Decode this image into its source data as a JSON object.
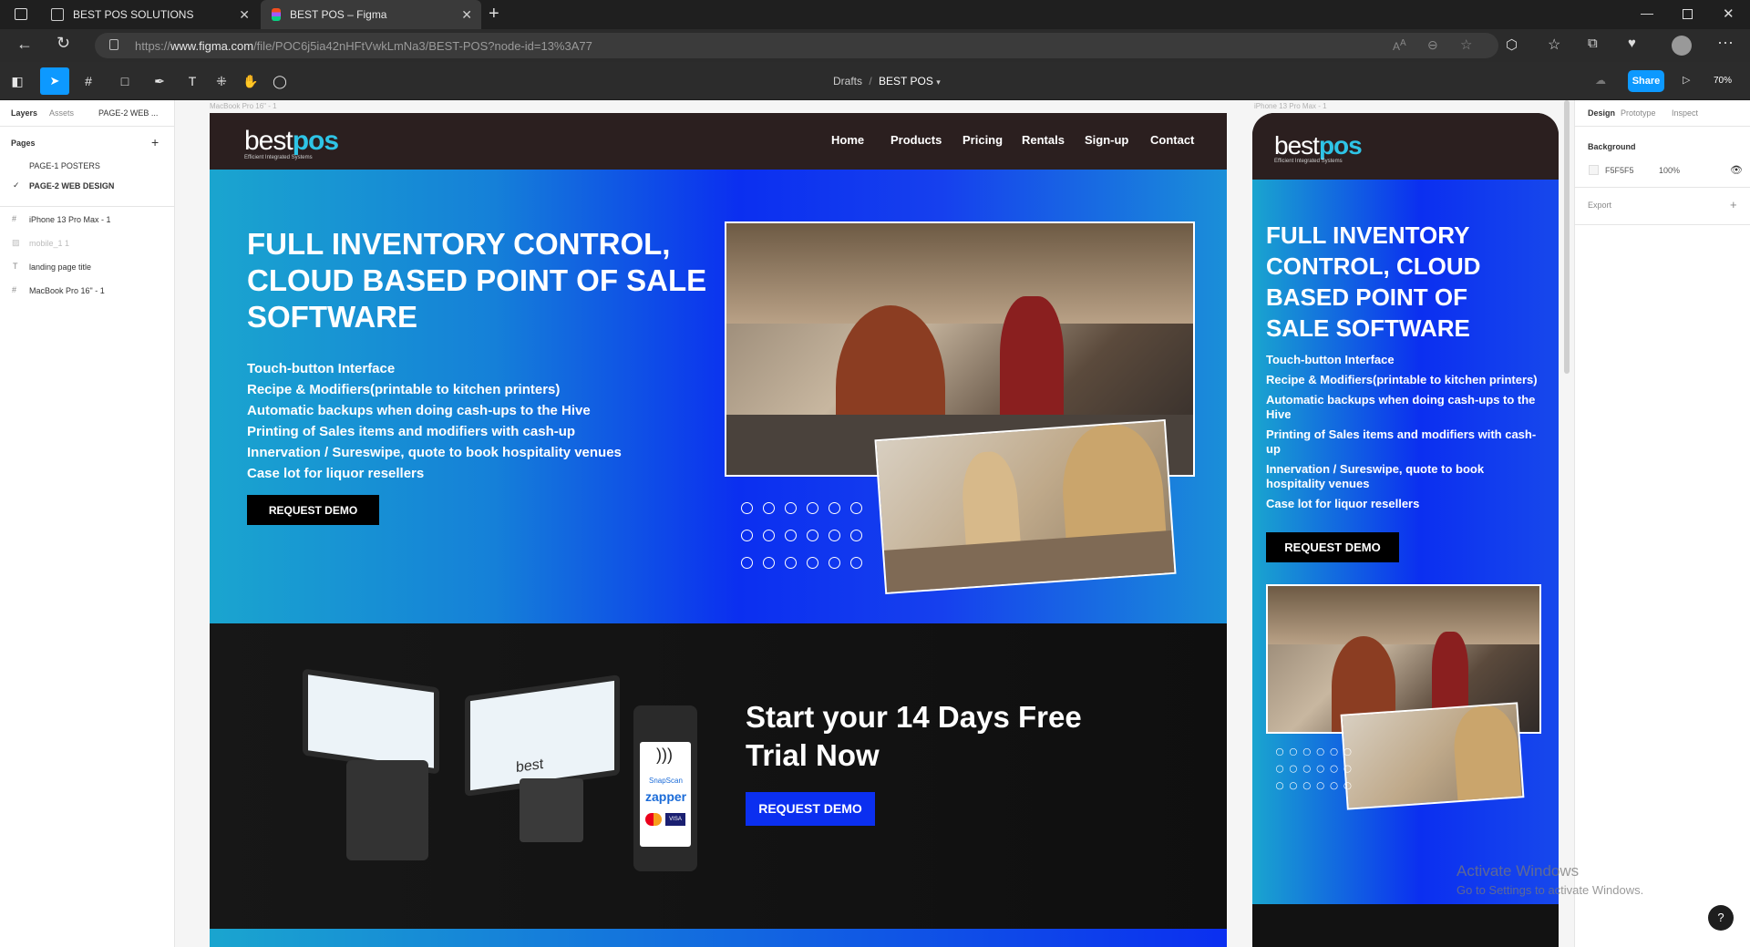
{
  "browser": {
    "tabs": [
      {
        "title": "BEST POS SOLUTIONS",
        "active": false
      },
      {
        "title": "BEST POS – Figma",
        "active": true
      }
    ],
    "url_prefix": "https://",
    "url_domain": "www.figma.com",
    "url_path": "/file/POC6j5ia42nHFtVwkLmNa3/BEST-POS?node-id=13%3A77"
  },
  "figma": {
    "breadcrumb_parent": "Drafts",
    "breadcrumb_sep": "/",
    "file_name": "BEST POS",
    "share_label": "Share",
    "zoom": "70%"
  },
  "left_panel": {
    "tabs": [
      "Layers",
      "Assets"
    ],
    "page_select": "PAGE-2 WEB ...",
    "pages_title": "Pages",
    "pages": [
      "PAGE-1 POSTERS",
      "PAGE-2 WEB DESIGN"
    ],
    "layers": [
      "iPhone 13 Pro Max - 1",
      "mobile_1 1",
      "landing page title",
      "MacBook Pro 16\" - 1"
    ]
  },
  "right_panel": {
    "tabs": [
      "Design",
      "Prototype",
      "Inspect"
    ],
    "background_label": "Background",
    "bg_hex": "F5F5F5",
    "bg_opacity": "100%",
    "export_label": "Export"
  },
  "canvas": {
    "desktop_label": "MacBook Pro 16\" - 1",
    "mobile_label": "iPhone 13 Pro Max - 1"
  },
  "site": {
    "logo_text_1": "best",
    "logo_text_2": "pos",
    "tagline": "Efficient Integrated Systems",
    "nav": [
      "Home",
      "Products",
      "Pricing",
      "Rentals",
      "Sign-up",
      "Contact"
    ],
    "hero_title_desktop": [
      "FULL INVENTORY CONTROL,",
      "CLOUD BASED POINT OF SALE",
      "SOFTWARE"
    ],
    "hero_title_mobile": [
      "FULL INVENTORY",
      "CONTROL, CLOUD",
      "BASED POINT OF",
      "SALE SOFTWARE"
    ],
    "features": [
      "Touch-button Interface",
      "Recipe & Modifiers(printable to kitchen printers)",
      "Automatic backups when doing cash-ups to the Hive",
      "Printing of Sales items and modifiers with cash-up",
      "Innervation / Sureswipe, quote to book hospitality venues",
      "Case lot for liquor resellers"
    ],
    "cta": "REQUEST DEMO",
    "trial_title_1": "Start your 14 Days Free",
    "trial_title_2": "Trial Now",
    "device_labels": [
      "SnapScan",
      "zapper"
    ]
  },
  "watermark": {
    "title": "Activate Windows",
    "subtitle": "Go to Settings to activate Windows."
  },
  "help": "?",
  "colors": {
    "figma_blue": "#0d99ff",
    "hero_blue": "#0b2ff0",
    "hero_cyan": "#1aa5cf",
    "nav_bg": "#2b1f1f"
  }
}
